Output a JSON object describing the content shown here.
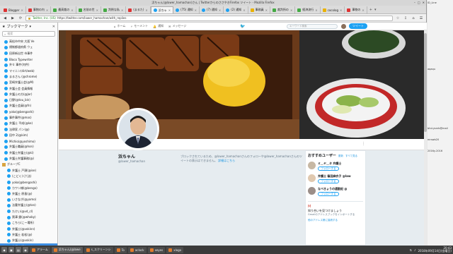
{
  "window": {
    "title": "浜ちゃん(@lawer_hamachan)さん | TwitterからのささやきFirefox ツイート - Mozilla Firefox",
    "controls": [
      "–",
      "□",
      "✕"
    ]
  },
  "tabs": [
    {
      "label": "Blogger",
      "icon": "rd"
    },
    {
      "label": "事物の内",
      "icon": "rd"
    },
    {
      "label": "最高裁の",
      "icon": "gr"
    },
    {
      "label": "名前の世",
      "icon": "gr"
    },
    {
      "label": "判例な私",
      "icon": "gr"
    },
    {
      "label": "(まるた)",
      "icon": "rd"
    },
    {
      "label": "浜ちゃ",
      "icon": "tw",
      "active": true
    },
    {
      "label": "(75) 通知",
      "icon": "tw"
    },
    {
      "label": "(7) 通知",
      "icon": "tw"
    },
    {
      "label": "(2) 通知",
      "icon": "tw"
    },
    {
      "label": "事務員",
      "icon": "yl"
    },
    {
      "label": "裁判所の",
      "icon": "gr"
    },
    {
      "label": "経済流行",
      "icon": "gr"
    },
    {
      "label": "cocolog",
      "icon": "yl"
    },
    {
      "label": "事物の",
      "icon": "rd"
    }
  ],
  "navbar": {
    "org": "Twitter, Inc. (US)",
    "url": "https://twitter.com/lawer_hamachan/with_replies"
  },
  "sidebar": {
    "title": "ブックマーク",
    "search_placeholder": "検索",
    "items": [
      {
        "label": "高松市中央 大阪 Ve",
        "type": "bm"
      },
      {
        "label": "規制都道府県 ウェ",
        "type": "bm"
      },
      {
        "label": "田原新出世 市事件",
        "type": "bm"
      },
      {
        "label": "Bloco Typewriter",
        "type": "bm"
      },
      {
        "label": "弁々 事件(何件)",
        "type": "bm"
      },
      {
        "label": "マイニン(dirt/web)",
        "type": "bm"
      },
      {
        "label": "まるさん (@chrome)",
        "type": "bm"
      },
      {
        "label": "宮崎弁護士会(@M)",
        "type": "bm"
      },
      {
        "label": "弁護士会 会員情報",
        "type": "bm"
      },
      {
        "label": "弁護士の方(@Jor)",
        "type": "bm"
      },
      {
        "label": "日野(@tou_bin)",
        "type": "bm"
      },
      {
        "label": "弁護士会員(@fn)",
        "type": "bm"
      },
      {
        "label": "yoko(@bengoshi)",
        "type": "bm"
      },
      {
        "label": "事件事件(@mos)",
        "type": "bm"
      },
      {
        "label": "弁護士 平成(@ke)",
        "type": "bm"
      },
      {
        "label": "法律家 パン(@)",
        "type": "bm"
      },
      {
        "label": "田中 2(@kim)",
        "type": "bm"
      },
      {
        "label": "Michio(@yoshimo)",
        "type": "bm"
      },
      {
        "label": "弁護士職員(@hon)",
        "type": "bm"
      },
      {
        "label": "弁護士弁護士(@ki)",
        "type": "bm"
      },
      {
        "label": "弁護士弁護事務(@)",
        "type": "bm"
      },
      {
        "label": "グループC",
        "type": "folder"
      },
      {
        "label": "弁護士 戸頭(@ise)",
        "type": "sub"
      },
      {
        "label": "(こどく) (六法)",
        "type": "sub"
      },
      {
        "label": "yoko(@bengoshi)",
        "type": "sub"
      },
      {
        "label": "カワン様(@bengo)",
        "type": "sub"
      },
      {
        "label": "弁護士 原島(@)",
        "type": "sub"
      },
      {
        "label": "いさなぎ(@yamo)",
        "type": "sub"
      },
      {
        "label": "法曹弁護士(@tan)",
        "type": "sub"
      },
      {
        "label": "たけい(@vd_cl)",
        "type": "sub"
      },
      {
        "label": "黒澤 銀(@whoby)",
        "type": "sub"
      },
      {
        "label": "こちら(こー場所)",
        "type": "sub"
      },
      {
        "label": "弁護士(@vokinn)",
        "type": "sub"
      },
      {
        "label": "弁護士 若松(@)",
        "type": "sub"
      },
      {
        "label": "弁護士(@vokin)",
        "type": "sub"
      },
      {
        "label": "弁護士 浜ちゃん",
        "type": "sub",
        "selected": true
      },
      {
        "label": "弁護士(@vokinn)",
        "type": "sub"
      }
    ]
  },
  "twitter": {
    "nav": {
      "home": "ホーム",
      "moments": "モーメント",
      "notifications": "通知",
      "messages": "メッセージ",
      "search_placeholder": "キーワード検索",
      "tweet_button": "ツイート"
    },
    "profile": {
      "name": "浜ちゃん",
      "handle": "@lawer_hamachan",
      "more": "⋮"
    },
    "blocked": {
      "text": "ブロックされているため、@lawer_hamachanさんのフォローや@lawer_hamachanさんのツイートの表示はできません。",
      "link": "詳細はこちら"
    },
    "recommend": {
      "title": "おすすめユーザー",
      "refresh": "更新",
      "view_all": "すべて見る",
      "users": [
        {
          "name": "ミ＿ヤ＿タ 弁護士",
          "follow": "フォローする"
        },
        {
          "name": "弁護士 篠田麻衣子 @law",
          "follow": "フォローする"
        },
        {
          "name": "なべきょうの通勤記 @",
          "follow": "フォローする"
        }
      ],
      "find": {
        "title": "知り合いを見つけましょう",
        "sub": "Gmailのアドレスブックをインポートする",
        "link": "他のアドレス帳に接続する"
      }
    }
  },
  "desktop_right": [
    {
      "label": "ID_Line"
    },
    {
      "label": "aqaqu"
    },
    {
      "label": "bhd-ysnrb@mail"
    },
    {
      "label": "mrswb20"
    },
    {
      "label": "2016y-2016"
    }
  ],
  "taskbar": {
    "tasks": [
      {
        "label": "アラーム"
      },
      {
        "label": "浜ちゃん(@lawe",
        "active": true
      },
      {
        "label": "s_スクリーンシ"
      },
      {
        "label": "To"
      },
      {
        "label": "aclock"
      },
      {
        "label": "xeyes"
      },
      {
        "label": "xlogo"
      }
    ],
    "clock_time": "20:43",
    "clock_date": "2018年09月14日(金曜日)"
  },
  "colors": {
    "twitter_blue": "#1da1f2",
    "selected_bookmark": "#3d8ee3"
  }
}
